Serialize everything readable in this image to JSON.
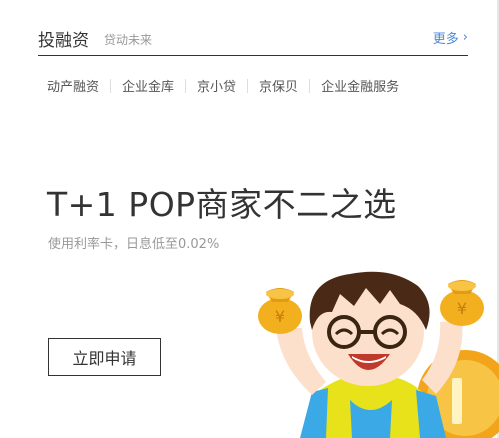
{
  "header": {
    "title": "投融资",
    "subtitle": "贷动未来",
    "more_label": "更多"
  },
  "tabs": [
    "动产融资",
    "企业金库",
    "京小贷",
    "京保贝",
    "企业金融服务"
  ],
  "promo": {
    "headline": "T+1 POP商家不二之选",
    "subline": "使用利率卡，日息低至0.02%",
    "button_label": "立即申请"
  },
  "illustration": {
    "bag_symbol": "¥",
    "colors": {
      "gold": "#f2b01e",
      "skin": "#fde0cc",
      "hair": "#4a2a16",
      "shirt_yellow": "#e7e21a",
      "shirt_blue": "#3aa9e5"
    }
  },
  "colors": {
    "accent": "#4d88d8",
    "text": "#333333",
    "muted": "#999999"
  },
  "icons": {
    "more": "chevron-right-icon"
  }
}
